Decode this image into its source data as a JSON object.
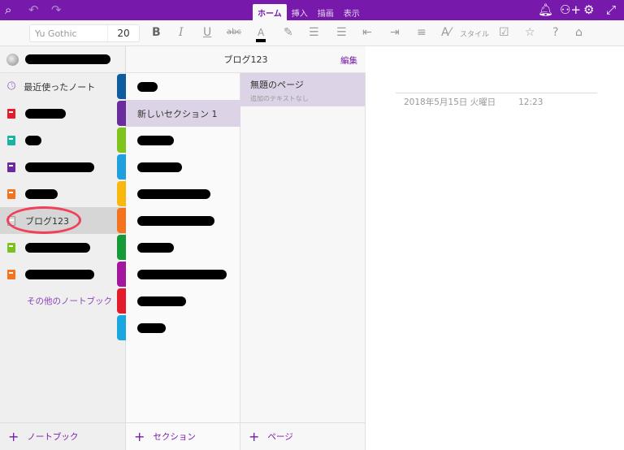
{
  "topbar": {
    "tabs": [
      "ホーム",
      "挿入",
      "描画",
      "表示"
    ],
    "active_tab": "ホーム",
    "accent": "#7719aa"
  },
  "toolbar": {
    "font_name": "Yu Gothic",
    "font_size": "20",
    "bold": "B",
    "italic": "I",
    "underline": "U",
    "strike": "abc",
    "font_color": "A",
    "style_label": "スタイル"
  },
  "sidebar": {
    "recent": "最近使ったノート",
    "selected_notebook": "ブログ123",
    "more_notebooks": "その他のノートブック",
    "add_label": "ノートブック",
    "notebook_colors": [
      "#e41b2b",
      "#19b4a6",
      "#6d2aa0",
      "#f5731c",
      "#9a9a9a",
      "#7cc11f",
      "#f5731c"
    ]
  },
  "sections": {
    "header": "ブログ123",
    "edit": "編集",
    "selected": "新しいセクション 1",
    "add_label": "セクション",
    "tab_colors": [
      "#0e5d9e",
      "#6a2d9c",
      "#7fc31c",
      "#1ea0de",
      "#f8b80f",
      "#f5731c",
      "#159a3a",
      "#a3179e",
      "#e31b2b",
      "#1aa6e0"
    ]
  },
  "pages": {
    "title": "無題のページ",
    "subtitle": "追加のテキストなし",
    "add_label": "ページ"
  },
  "content": {
    "date": "2018年5月15日 火曜日",
    "time": "12:23"
  }
}
